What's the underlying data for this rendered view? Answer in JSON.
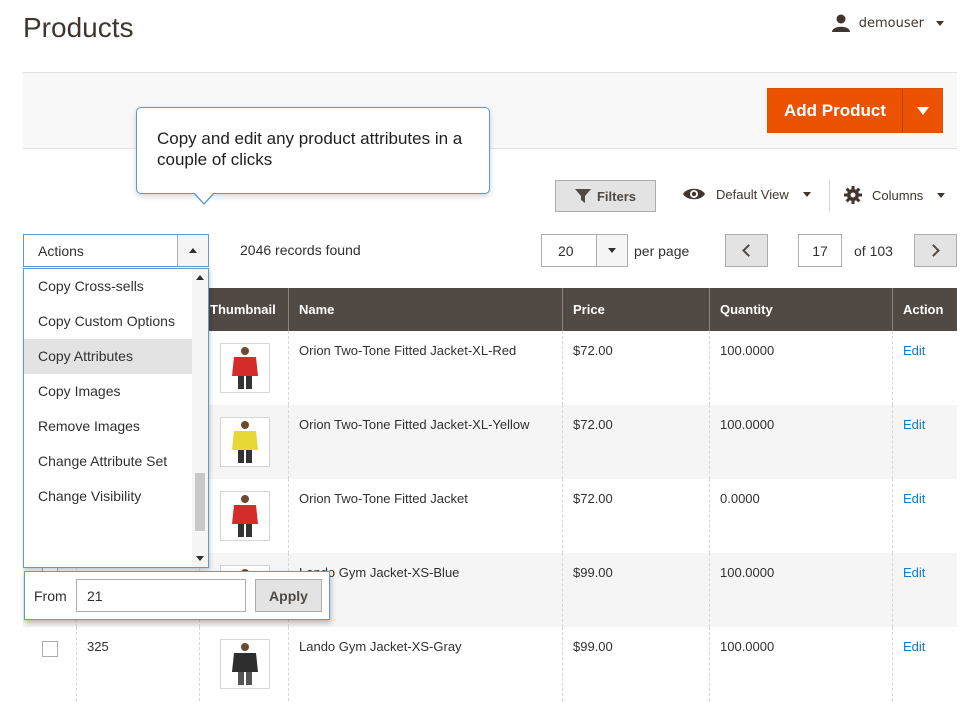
{
  "header": {
    "page_title": "Products",
    "user_name": "demouser"
  },
  "action_bar": {
    "add_product_label": "Add Product"
  },
  "tooltip": {
    "text": "Copy and edit any product attributes in a couple of clicks"
  },
  "toolbar": {
    "filters_label": "Filters",
    "view_label": "Default View",
    "columns_label": "Columns",
    "actions_label": "Actions",
    "records_found": "2046 records found",
    "per_page_value": "20",
    "per_page_label": "per page",
    "current_page": "17",
    "total_pages": "of 103"
  },
  "actions_menu": {
    "items": [
      {
        "label": "Copy Cross-sells"
      },
      {
        "label": "Copy Custom Options"
      },
      {
        "label": "Copy Attributes"
      },
      {
        "label": "Copy Images"
      },
      {
        "label": "Remove Images"
      },
      {
        "label": "Change Attribute Set"
      },
      {
        "label": "Change Visibility"
      }
    ],
    "active_index": 2,
    "from_label": "From",
    "from_value": "21",
    "apply_label": "Apply"
  },
  "grid": {
    "columns": [
      "Thumbnail",
      "Name",
      "Price",
      "Quantity",
      "Action"
    ],
    "rows": [
      {
        "id": "",
        "name": "Orion Two-Tone Fitted Jacket-XL-Red",
        "price": "$72.00",
        "qty": "100.0000",
        "action": "Edit",
        "thumb_color": "#d62b2b"
      },
      {
        "id": "",
        "name": "Orion Two-Tone Fitted Jacket-XL-Yellow",
        "price": "$72.00",
        "qty": "100.0000",
        "action": "Edit",
        "thumb_color": "#e8d836"
      },
      {
        "id": "",
        "name": "Orion Two-Tone Fitted Jacket",
        "price": "$72.00",
        "qty": "0.0000",
        "action": "Edit",
        "thumb_color": "#d62b2b"
      },
      {
        "id": "",
        "name": "Lando Gym Jacket-XS-Blue",
        "price": "$99.00",
        "qty": "100.0000",
        "action": "Edit",
        "thumb_color": "#2c5fa8"
      },
      {
        "id": "325",
        "name": "Lando Gym Jacket-XS-Gray",
        "price": "$99.00",
        "qty": "100.0000",
        "action": "Edit",
        "thumb_color": "#2e2e2e"
      }
    ]
  },
  "colors": {
    "accent": "#eb5202",
    "header_bg": "#514943",
    "link": "#1979c3",
    "focus_border": "#5d9ad1"
  }
}
